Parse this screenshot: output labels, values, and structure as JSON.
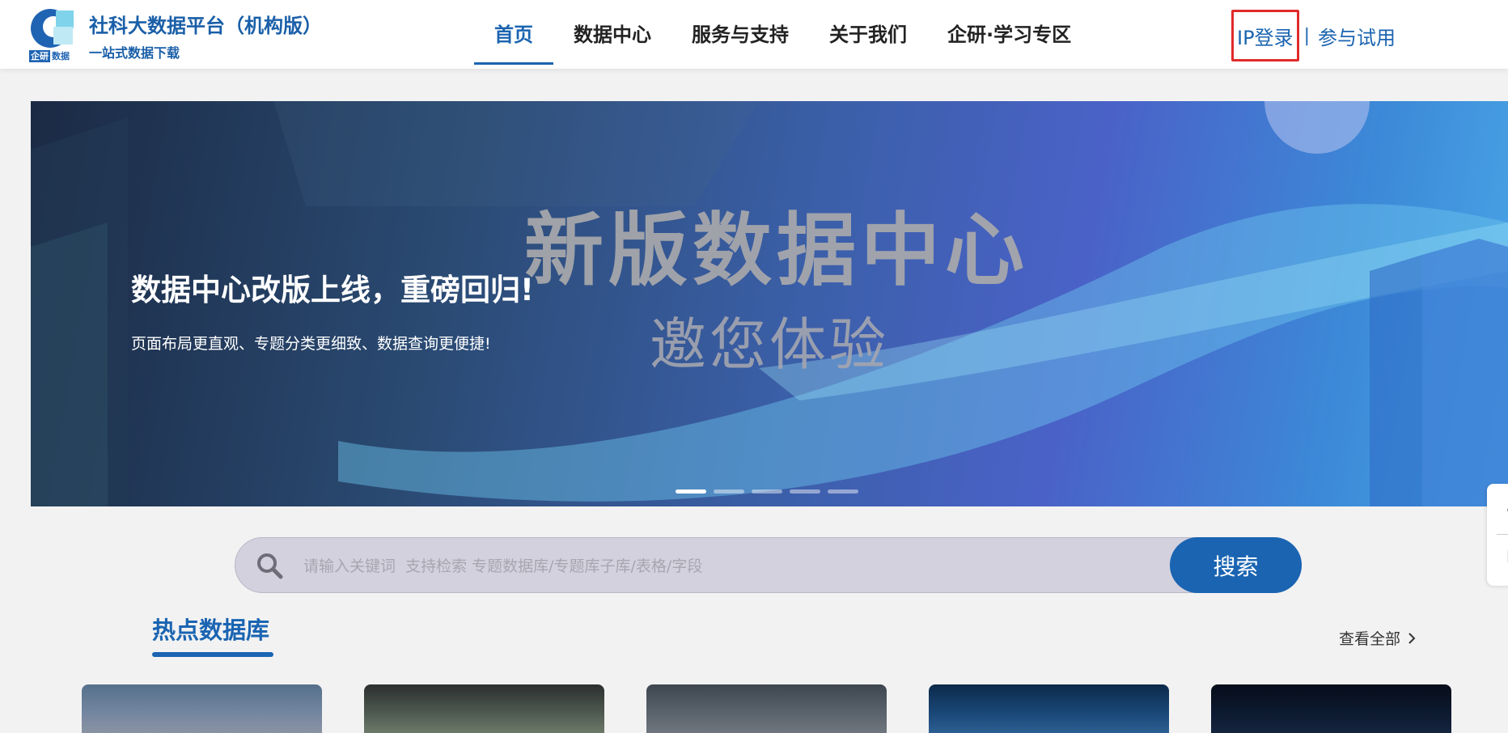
{
  "header": {
    "logo_badge_left": "企研",
    "logo_badge_right": "数据",
    "title": "社科大数据平台（机构版）",
    "subtitle": "一站式数据下载",
    "nav": [
      {
        "label": "首页",
        "active": true
      },
      {
        "label": "数据中心",
        "active": false
      },
      {
        "label": "服务与支持",
        "active": false
      },
      {
        "label": "关于我们",
        "active": false
      },
      {
        "label": "企研·学习专区",
        "active": false
      }
    ],
    "ip_login": "IP登录",
    "separator": "|",
    "trial": "参与试用"
  },
  "banner": {
    "bg_title": "新版数据中心",
    "bg_subtitle": "邀您体验",
    "headline": "数据中心改版上线，重磅回归!",
    "description": "页面布局更直观、专题分类更细致、数据查询更便捷!",
    "slide_count": 5,
    "active_slide": 1
  },
  "search": {
    "placeholder": "请输入关键词  支持检索 专题数据库/专题库子库/表格/字段",
    "button": "搜索"
  },
  "hot": {
    "title": "热点数据库",
    "view_all": "查看全部"
  },
  "colors": {
    "brand": "#1a64b2",
    "highlight_border": "#e02b2b"
  }
}
